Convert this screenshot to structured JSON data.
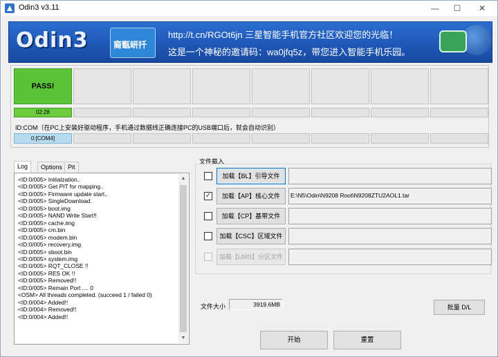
{
  "window": {
    "title": "Odin3 v3.11",
    "controls": {
      "minimize": "—",
      "maximize": "☐",
      "close": "✕"
    }
  },
  "banner": {
    "logo": "Odin3",
    "stamp": "裔甑岍扦",
    "line1": "http://t.cn/RGOt6jn 三星智能手机官方社区欢迎您的光临！",
    "line2": "这是一个神秘的邀请码：wa0jfq5z，带您进入智能手机乐园。",
    "icon_names": [
      "chat-bubble-icon",
      "globe-icon"
    ]
  },
  "ports": {
    "pass_label": "PASS!",
    "time": "02:28",
    "idcom_label": "ID:COM（在PC上安装好驱动程序，手机通过数据线正确连接PC的USB端口后，就会自动识别）",
    "com": "0:[COM4]",
    "colors": {
      "pass": "#5bc338",
      "com_active": "#b8dcef"
    }
  },
  "tabs": [
    "Log",
    "Options",
    "Pit"
  ],
  "log": [
    "<ID:0/005> Initialzation..",
    "<ID:0/005> Get PIT for mapping..",
    "<ID:0/005> Firmware update start..",
    "<ID:0/005> SingleDownload.",
    "<ID:0/005> boot.img",
    "<ID:0/005> NAND Write Start!!",
    "<ID:0/005> cache.img",
    "<ID:0/005> cm.bin",
    "<ID:0/005> modem.bin",
    "<ID:0/005> recovery.img",
    "<ID:0/005> sboot.bin",
    "<ID:0/005> system.img",
    "<ID:0/005> RQT_CLOSE !!",
    "<ID:0/005> RES OK !!",
    "<ID:0/005> Removed!!",
    "<ID:0/005> Remain Port ....  0",
    "<OSM> All threads completed. (succeed 1 / failed 0)",
    "<ID:0/004> Added!!",
    "<ID:0/004> Removed!!",
    "<ID:0/004> Added!!"
  ],
  "files": {
    "group_label": "文件载入",
    "rows": [
      {
        "button": "加载【BL】引导文件",
        "path": "",
        "checked": false
      },
      {
        "button": "加载【AP】核心文件",
        "path": "E:\\N5\\Odin\\N9208 Root\\N9208ZTU2AOL1.tar",
        "checked": true
      },
      {
        "button": "加载【CP】基带文件",
        "path": "",
        "checked": false
      },
      {
        "button": "加载【CSC】区域文件",
        "path": "",
        "checked": false
      },
      {
        "button": "加载【UMS】分区文件",
        "path": "",
        "checked": false
      }
    ],
    "checkmark": "✓"
  },
  "size": {
    "label": "文件大小",
    "value": "3919.6MB"
  },
  "actions": {
    "batch": "批量 D/L",
    "start": "开始",
    "reset": "重置"
  },
  "scroll_arrows": {
    "up": "▲",
    "down": "▼"
  }
}
